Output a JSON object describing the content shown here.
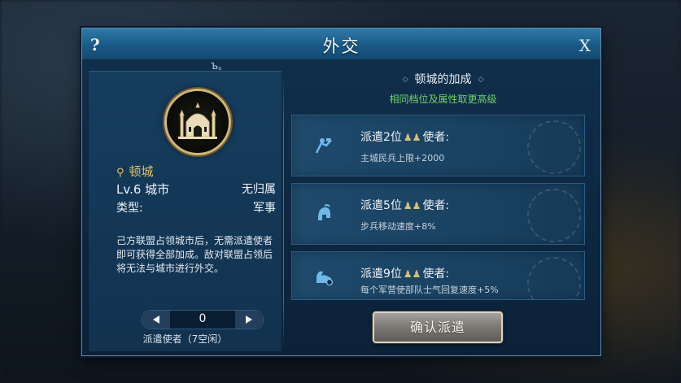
{
  "dialog": {
    "title": "外交",
    "help_label": "?",
    "close_label": "X",
    "cursor_glyph": "Ъ。"
  },
  "city": {
    "name": "顿城",
    "level_text": "Lv.6 城市",
    "owner_text": "无归属",
    "type_label": "类型:",
    "type_value": "军事",
    "description": "己方联盟占领城市后，无需派遣使者即可获得全部加成。敌对联盟占领后将无法与城市进行外交。"
  },
  "stepper": {
    "value": "0",
    "caption": "派遣使者（7空闲）",
    "left_icon": "triangle-left-icon",
    "right_icon": "triangle-right-icon"
  },
  "bonus_panel": {
    "header": "顿城的加成",
    "subheader": "相同档位及属性取更高级",
    "items": [
      {
        "title_prefix": "派遣2位",
        "title_suffix": "使者:",
        "desc": "主城民兵上限+2000",
        "icon": "militia-flag-icon"
      },
      {
        "title_prefix": "派遣5位",
        "title_suffix": "使者:",
        "desc": "步兵移动速度+8%",
        "icon": "infantry-helmet-icon"
      },
      {
        "title_prefix": "派遣9位",
        "title_suffix": "使者:",
        "desc": "每个军营使部队士气回复速度+5%",
        "icon": "morale-arm-icon"
      }
    ]
  },
  "actions": {
    "confirm_label": "确认派遣"
  },
  "colors": {
    "gold": "#e3c163",
    "green_note": "#6fd36a",
    "title_bar": "#1a5a86"
  }
}
